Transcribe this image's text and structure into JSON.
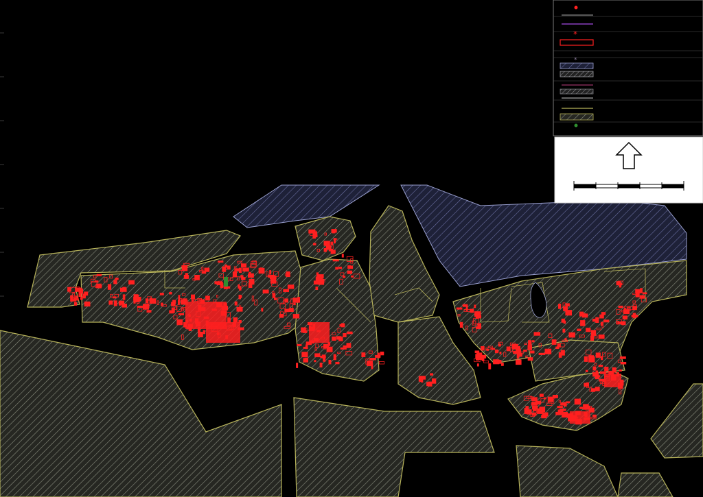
{
  "map": {
    "background": "#000000",
    "parcel_fill": "#262722",
    "parcel_hatch": "#8b8f80",
    "parcel_outline": "#b7b35a",
    "water_fill": "#1e2138",
    "water_hatch": "#6f74a8",
    "water_outline": "#9aa0d0",
    "building_color": "#ff2020",
    "marker_green": "#2f8f2f"
  },
  "legend": {
    "items": [
      {
        "symbol": "red-dot-icon",
        "color": "#ff2020"
      },
      {
        "symbol": "purple-line-icon",
        "color": "#8a3fc0"
      },
      {
        "symbol": "red-asterisk-icon",
        "color": "#ff2020"
      },
      {
        "symbol": "red-rectangle-icon",
        "color": "#ff2020"
      },
      {
        "symbol": "small-asterisk-icon",
        "color": "#8a7a9a"
      },
      {
        "symbol": "blue-hatch-swatch-icon",
        "color": "#6f74a8"
      },
      {
        "symbol": "gray-hatch-swatch-icon",
        "color": "#8b8f80"
      },
      {
        "symbol": "pink-line-icon",
        "color": "#c04080"
      },
      {
        "symbol": "light-hatch-swatch-icon",
        "color": "#9a9aa0"
      },
      {
        "symbol": "yellow-line-icon",
        "color": "#b7b35a"
      },
      {
        "symbol": "yellow-line-icon-2",
        "color": "#b7b35a"
      },
      {
        "symbol": "olive-hatch-swatch-icon",
        "color": "#8b8f80"
      },
      {
        "symbol": "green-dot-icon",
        "color": "#2f8f2f"
      }
    ]
  },
  "north_arrow": {
    "symbol": "north-arrow-icon"
  },
  "scale_bar": {
    "symbol": "scale-bar-icon",
    "segments": 5
  }
}
